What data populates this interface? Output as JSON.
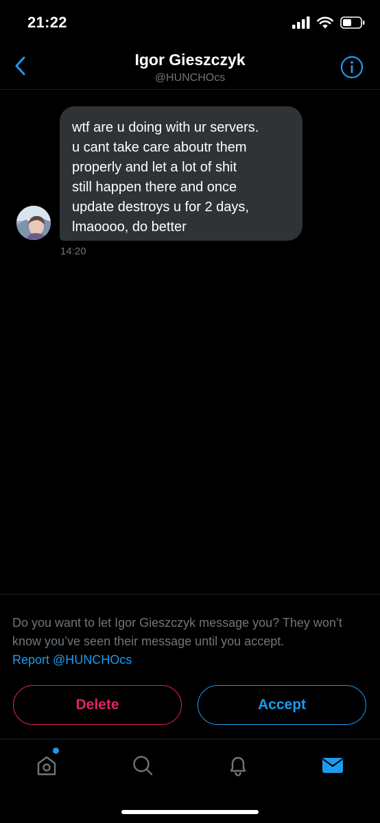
{
  "status_bar": {
    "time": "21:22",
    "icons": [
      "cellular-signal-icon",
      "wifi-icon",
      "battery-icon"
    ]
  },
  "header": {
    "title": "Igor Gieszczyk",
    "handle": "@HUNCHOcs",
    "back_icon": "chevron-left-icon",
    "info_icon": "info-icon"
  },
  "conversation": {
    "messages": [
      {
        "text": "wtf are u doing with ur servers.\nu cant take care aboutr them\nproperly and let a lot of shit\nstill happen there and once\nupdate destroys u for 2 days,\nlmaoooo, do better",
        "time": "14:20"
      }
    ]
  },
  "request": {
    "prompt": "Do you want to let Igor Gieszczyk message you? They won’t know you’ve seen their message until you accept.",
    "report_link": "Report @HUNCHOcs",
    "delete_label": "Delete",
    "accept_label": "Accept"
  },
  "tab_bar": {
    "tabs": [
      "home-icon",
      "search-icon",
      "notifications-icon",
      "messages-icon"
    ],
    "active": "messages-icon"
  },
  "colors": {
    "background": "#000000",
    "bubble": "#2f3336",
    "accent": "#1d9bf0",
    "danger": "#e0245e",
    "muted": "#6e767d"
  }
}
